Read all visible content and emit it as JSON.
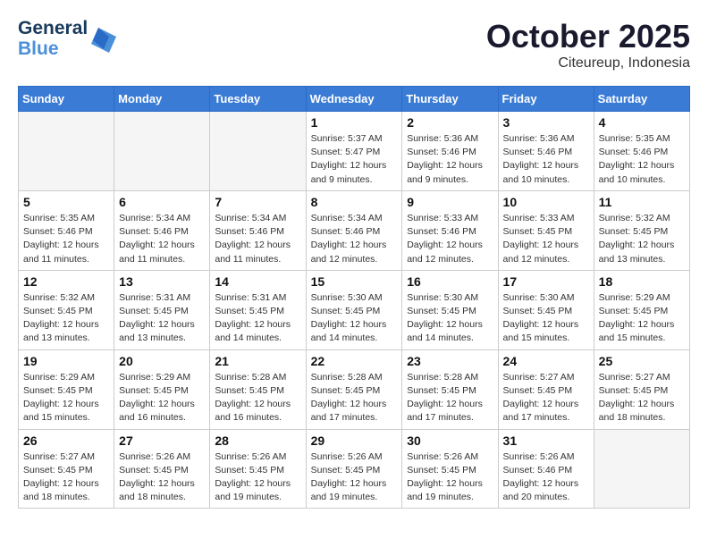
{
  "header": {
    "logo_line1": "General",
    "logo_line2": "Blue",
    "month": "October 2025",
    "location": "Citeureup, Indonesia"
  },
  "weekdays": [
    "Sunday",
    "Monday",
    "Tuesday",
    "Wednesday",
    "Thursday",
    "Friday",
    "Saturday"
  ],
  "weeks": [
    [
      {
        "day": "",
        "info": ""
      },
      {
        "day": "",
        "info": ""
      },
      {
        "day": "",
        "info": ""
      },
      {
        "day": "1",
        "info": "Sunrise: 5:37 AM\nSunset: 5:47 PM\nDaylight: 12 hours\nand 9 minutes."
      },
      {
        "day": "2",
        "info": "Sunrise: 5:36 AM\nSunset: 5:46 PM\nDaylight: 12 hours\nand 9 minutes."
      },
      {
        "day": "3",
        "info": "Sunrise: 5:36 AM\nSunset: 5:46 PM\nDaylight: 12 hours\nand 10 minutes."
      },
      {
        "day": "4",
        "info": "Sunrise: 5:35 AM\nSunset: 5:46 PM\nDaylight: 12 hours\nand 10 minutes."
      }
    ],
    [
      {
        "day": "5",
        "info": "Sunrise: 5:35 AM\nSunset: 5:46 PM\nDaylight: 12 hours\nand 11 minutes."
      },
      {
        "day": "6",
        "info": "Sunrise: 5:34 AM\nSunset: 5:46 PM\nDaylight: 12 hours\nand 11 minutes."
      },
      {
        "day": "7",
        "info": "Sunrise: 5:34 AM\nSunset: 5:46 PM\nDaylight: 12 hours\nand 11 minutes."
      },
      {
        "day": "8",
        "info": "Sunrise: 5:34 AM\nSunset: 5:46 PM\nDaylight: 12 hours\nand 12 minutes."
      },
      {
        "day": "9",
        "info": "Sunrise: 5:33 AM\nSunset: 5:46 PM\nDaylight: 12 hours\nand 12 minutes."
      },
      {
        "day": "10",
        "info": "Sunrise: 5:33 AM\nSunset: 5:45 PM\nDaylight: 12 hours\nand 12 minutes."
      },
      {
        "day": "11",
        "info": "Sunrise: 5:32 AM\nSunset: 5:45 PM\nDaylight: 12 hours\nand 13 minutes."
      }
    ],
    [
      {
        "day": "12",
        "info": "Sunrise: 5:32 AM\nSunset: 5:45 PM\nDaylight: 12 hours\nand 13 minutes."
      },
      {
        "day": "13",
        "info": "Sunrise: 5:31 AM\nSunset: 5:45 PM\nDaylight: 12 hours\nand 13 minutes."
      },
      {
        "day": "14",
        "info": "Sunrise: 5:31 AM\nSunset: 5:45 PM\nDaylight: 12 hours\nand 14 minutes."
      },
      {
        "day": "15",
        "info": "Sunrise: 5:30 AM\nSunset: 5:45 PM\nDaylight: 12 hours\nand 14 minutes."
      },
      {
        "day": "16",
        "info": "Sunrise: 5:30 AM\nSunset: 5:45 PM\nDaylight: 12 hours\nand 14 minutes."
      },
      {
        "day": "17",
        "info": "Sunrise: 5:30 AM\nSunset: 5:45 PM\nDaylight: 12 hours\nand 15 minutes."
      },
      {
        "day": "18",
        "info": "Sunrise: 5:29 AM\nSunset: 5:45 PM\nDaylight: 12 hours\nand 15 minutes."
      }
    ],
    [
      {
        "day": "19",
        "info": "Sunrise: 5:29 AM\nSunset: 5:45 PM\nDaylight: 12 hours\nand 15 minutes."
      },
      {
        "day": "20",
        "info": "Sunrise: 5:29 AM\nSunset: 5:45 PM\nDaylight: 12 hours\nand 16 minutes."
      },
      {
        "day": "21",
        "info": "Sunrise: 5:28 AM\nSunset: 5:45 PM\nDaylight: 12 hours\nand 16 minutes."
      },
      {
        "day": "22",
        "info": "Sunrise: 5:28 AM\nSunset: 5:45 PM\nDaylight: 12 hours\nand 17 minutes."
      },
      {
        "day": "23",
        "info": "Sunrise: 5:28 AM\nSunset: 5:45 PM\nDaylight: 12 hours\nand 17 minutes."
      },
      {
        "day": "24",
        "info": "Sunrise: 5:27 AM\nSunset: 5:45 PM\nDaylight: 12 hours\nand 17 minutes."
      },
      {
        "day": "25",
        "info": "Sunrise: 5:27 AM\nSunset: 5:45 PM\nDaylight: 12 hours\nand 18 minutes."
      }
    ],
    [
      {
        "day": "26",
        "info": "Sunrise: 5:27 AM\nSunset: 5:45 PM\nDaylight: 12 hours\nand 18 minutes."
      },
      {
        "day": "27",
        "info": "Sunrise: 5:26 AM\nSunset: 5:45 PM\nDaylight: 12 hours\nand 18 minutes."
      },
      {
        "day": "28",
        "info": "Sunrise: 5:26 AM\nSunset: 5:45 PM\nDaylight: 12 hours\nand 19 minutes."
      },
      {
        "day": "29",
        "info": "Sunrise: 5:26 AM\nSunset: 5:45 PM\nDaylight: 12 hours\nand 19 minutes."
      },
      {
        "day": "30",
        "info": "Sunrise: 5:26 AM\nSunset: 5:45 PM\nDaylight: 12 hours\nand 19 minutes."
      },
      {
        "day": "31",
        "info": "Sunrise: 5:26 AM\nSunset: 5:46 PM\nDaylight: 12 hours\nand 20 minutes."
      },
      {
        "day": "",
        "info": ""
      }
    ]
  ]
}
